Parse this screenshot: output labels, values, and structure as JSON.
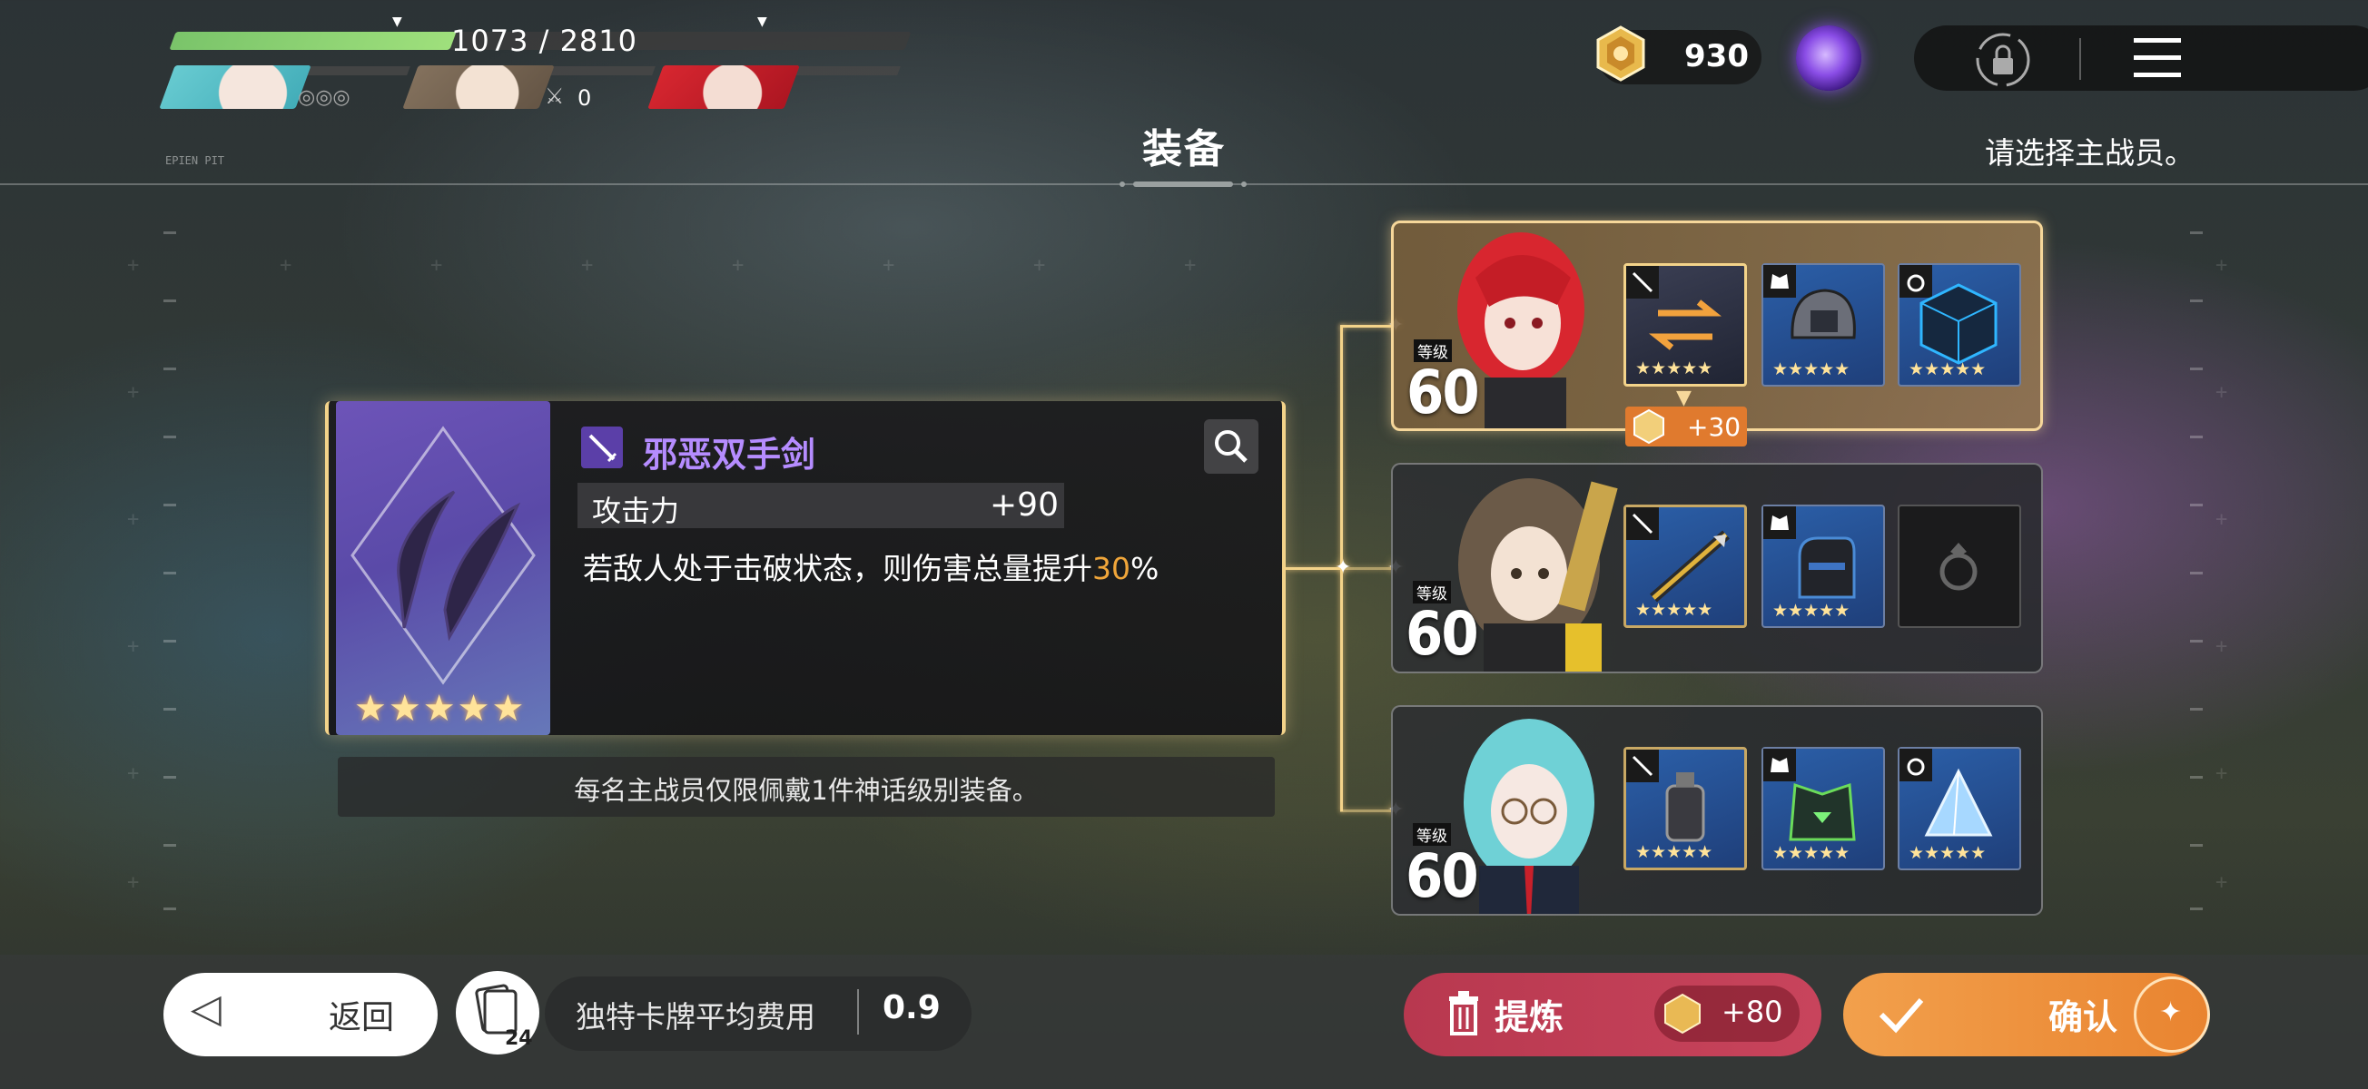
{
  "party": {
    "hp_text": "1073 / 2810",
    "hp_fraction": 0.382,
    "member2_count": "0"
  },
  "currency": {
    "value": "930"
  },
  "header": {
    "title": "装备",
    "hint": "请选择主战员。",
    "small_logo": "EPIEN PIT"
  },
  "equipment": {
    "name": "邪恶双手剑",
    "stars": "★★★★★",
    "stat_label": "攻击力",
    "stat_value": "+90",
    "effect_prefix": "若敌人处于击破状态，则伤害总量提升",
    "effect_highlight": "30",
    "effect_suffix": "%",
    "note": "每名主战员仅限佩戴1件神话级别装备。",
    "accent_color": "#b58cff"
  },
  "characters": [
    {
      "level_label": "等级",
      "level": "60",
      "bonus": "+30",
      "slot_stars": [
        "★★★★★",
        "★★★★★",
        "★★★★★"
      ],
      "hair_color": "#d8262f"
    },
    {
      "level_label": "等级",
      "level": "60",
      "slot_stars": [
        "★★★★★",
        "★★★★★"
      ],
      "hair_color": "#6b5a48"
    },
    {
      "level_label": "等级",
      "level": "60",
      "slot_stars": [
        "★★★★★",
        "★★★★★",
        "★★★★★"
      ],
      "hair_color": "#6fd1d6"
    }
  ],
  "bottom": {
    "back_label": "返回",
    "deck_count": "24",
    "cost_label": "独特卡牌平均费用",
    "cost_value": "0.9",
    "refine_label": "提炼",
    "refine_cost": "+80",
    "confirm_label": "确认"
  }
}
